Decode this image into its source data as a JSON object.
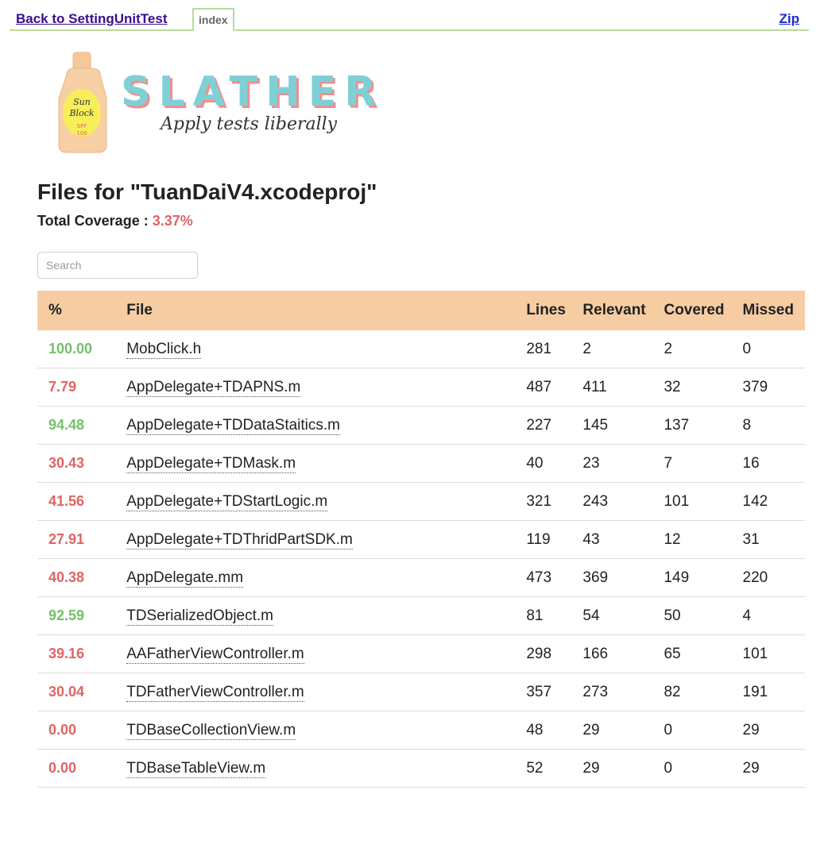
{
  "nav": {
    "back_label": "Back to SettingUnitTest",
    "tab_label": "index",
    "zip_label": "Zip"
  },
  "logo": {
    "brand": "SLATHER",
    "tagline": "Apply tests liberally",
    "bottle_text_1": "Sun",
    "bottle_text_2": "Block",
    "bottle_text_3": "SPF",
    "bottle_text_4": "100"
  },
  "page": {
    "title": "Files for \"TuanDaiV4.xcodeproj\"",
    "coverage_label": "Total Coverage :",
    "coverage_value": "3.37%"
  },
  "search": {
    "placeholder": "Search",
    "value": ""
  },
  "table": {
    "headers": [
      "%",
      "File",
      "Lines",
      "Relevant",
      "Covered",
      "Missed"
    ],
    "rows": [
      {
        "pct": "100.00",
        "status": "good",
        "file": "MobClick.h",
        "lines": "281",
        "relevant": "2",
        "covered": "2",
        "missed": "0"
      },
      {
        "pct": "7.79",
        "status": "bad",
        "file": "AppDelegate+TDAPNS.m",
        "lines": "487",
        "relevant": "411",
        "covered": "32",
        "missed": "379"
      },
      {
        "pct": "94.48",
        "status": "good",
        "file": "AppDelegate+TDDataStaitics.m",
        "lines": "227",
        "relevant": "145",
        "covered": "137",
        "missed": "8"
      },
      {
        "pct": "30.43",
        "status": "bad",
        "file": "AppDelegate+TDMask.m",
        "lines": "40",
        "relevant": "23",
        "covered": "7",
        "missed": "16"
      },
      {
        "pct": "41.56",
        "status": "bad",
        "file": "AppDelegate+TDStartLogic.m",
        "lines": "321",
        "relevant": "243",
        "covered": "101",
        "missed": "142"
      },
      {
        "pct": "27.91",
        "status": "bad",
        "file": "AppDelegate+TDThridPartSDK.m",
        "lines": "119",
        "relevant": "43",
        "covered": "12",
        "missed": "31"
      },
      {
        "pct": "40.38",
        "status": "bad",
        "file": "AppDelegate.mm",
        "lines": "473",
        "relevant": "369",
        "covered": "149",
        "missed": "220"
      },
      {
        "pct": "92.59",
        "status": "good",
        "file": "TDSerializedObject.m",
        "lines": "81",
        "relevant": "54",
        "covered": "50",
        "missed": "4"
      },
      {
        "pct": "39.16",
        "status": "bad",
        "file": "AAFatherViewController.m",
        "lines": "298",
        "relevant": "166",
        "covered": "65",
        "missed": "101"
      },
      {
        "pct": "30.04",
        "status": "bad",
        "file": "TDFatherViewController.m",
        "lines": "357",
        "relevant": "273",
        "covered": "82",
        "missed": "191"
      },
      {
        "pct": "0.00",
        "status": "bad",
        "file": "TDBaseCollectionView.m",
        "lines": "48",
        "relevant": "29",
        "covered": "0",
        "missed": "29"
      },
      {
        "pct": "0.00",
        "status": "bad",
        "file": "TDBaseTableView.m",
        "lines": "52",
        "relevant": "29",
        "covered": "0",
        "missed": "29"
      }
    ]
  },
  "colors": {
    "good": "#75c06b",
    "bad": "#e06464",
    "header_bg": "#f6cda3",
    "tab_border": "#b7dc9c"
  }
}
